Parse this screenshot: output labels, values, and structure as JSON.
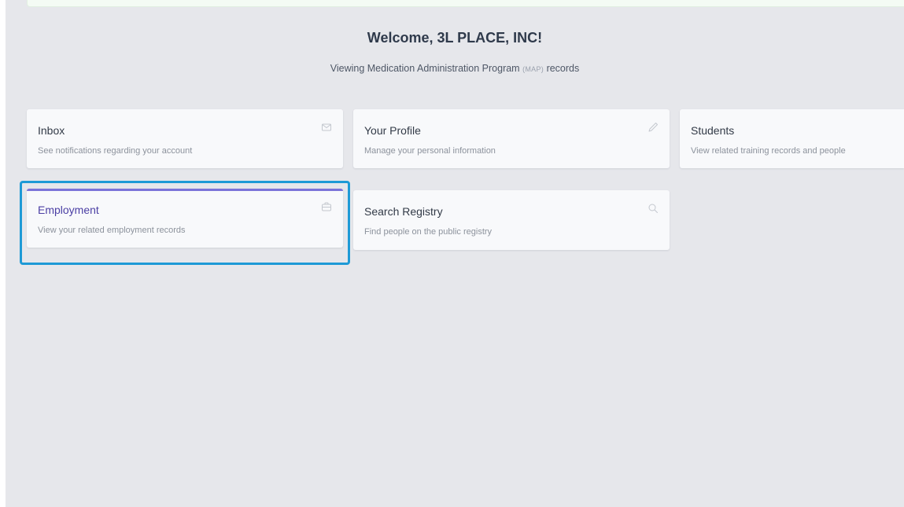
{
  "header": {
    "welcome": "Welcome, 3L PLACE, INC!",
    "subtitle_before": "Viewing Medication Administration Program",
    "subtitle_abbr": "(MAP)",
    "subtitle_after": "records"
  },
  "cards": [
    {
      "title": "Inbox",
      "description": "See notifications regarding your account",
      "icon": "envelope-icon"
    },
    {
      "title": "Your Profile",
      "description": "Manage your personal information",
      "icon": "pencil-icon"
    },
    {
      "title": "Students",
      "description": "View related training records and people",
      "icon": ""
    },
    {
      "title": "Employment",
      "description": "View your related employment records",
      "icon": "briefcase-icon",
      "active": true
    },
    {
      "title": "Search Registry",
      "description": "Find people on the public registry",
      "icon": "search-icon"
    }
  ],
  "colors": {
    "background": "#e6e7eb",
    "card": "#f8f9fb",
    "active_accent": "#7b74d9",
    "active_title": "#4b3fa4",
    "highlight": "#1e9ad6"
  }
}
